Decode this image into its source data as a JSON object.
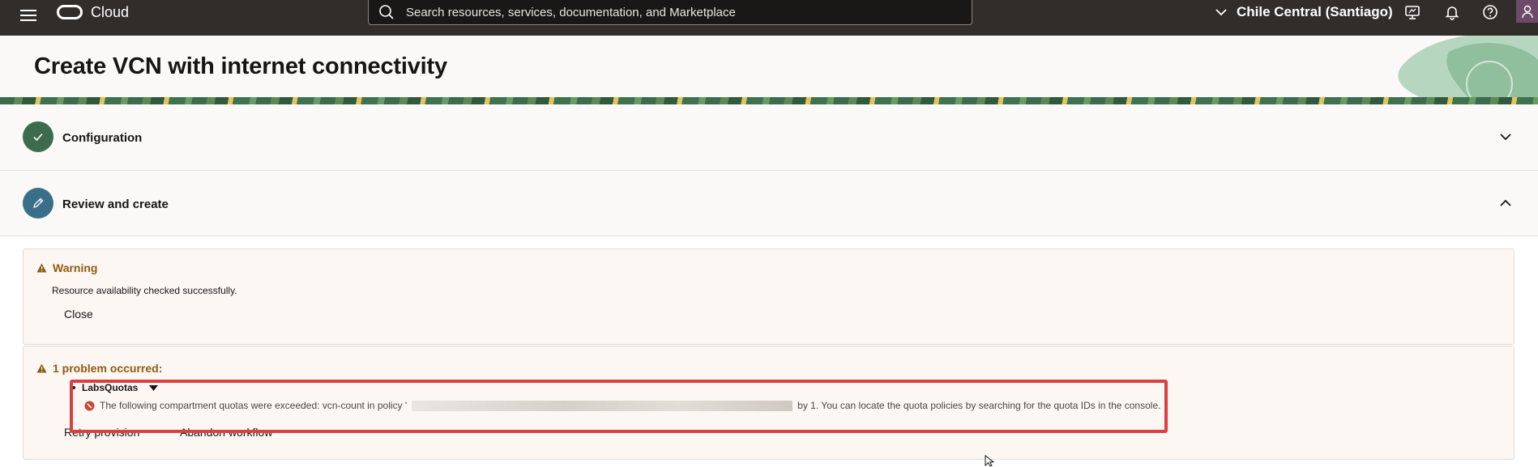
{
  "topbar": {
    "brand": "Cloud",
    "search_placeholder": "Search resources, services, documentation, and Marketplace",
    "region": "Chile Central (Santiago)"
  },
  "header": {
    "title": "Create VCN with internet connectivity"
  },
  "steps": [
    {
      "label": "Configuration",
      "state": "complete"
    },
    {
      "label": "Review and create",
      "state": "current"
    }
  ],
  "warning": {
    "title": "Warning",
    "message": "Resource availability checked successfully.",
    "close_label": "Close"
  },
  "problem": {
    "title": "1 problem occurred:",
    "item_label": "LabsQuotas",
    "error_prefix": "The following compartment quotas were exceeded: vcn-count in policy '",
    "error_suffix": "by 1. You can locate the quota policies by searching for the quota IDs in the console.",
    "retry_label": "Retry provision",
    "abandon_label": "Abandon workflow"
  },
  "colors": {
    "topbar": "#312d2a",
    "header_bg": "#fbf9f8",
    "step_complete": "#3d6b4d",
    "step_current": "#3a6f8a",
    "warning_text": "#8f5a12",
    "error_red": "#c74634",
    "highlight": "#d94040"
  },
  "icons": {
    "menu": "hamburger-icon",
    "search": "search-icon",
    "region": "chevron-down-icon",
    "console": "monitor-icon",
    "notifications": "bell-icon",
    "help": "help-icon",
    "user": "user-icon",
    "step_done": "check-icon",
    "step_edit": "pencil-icon",
    "warning": "warning-triangle-icon",
    "error": "error-circle-icon"
  }
}
